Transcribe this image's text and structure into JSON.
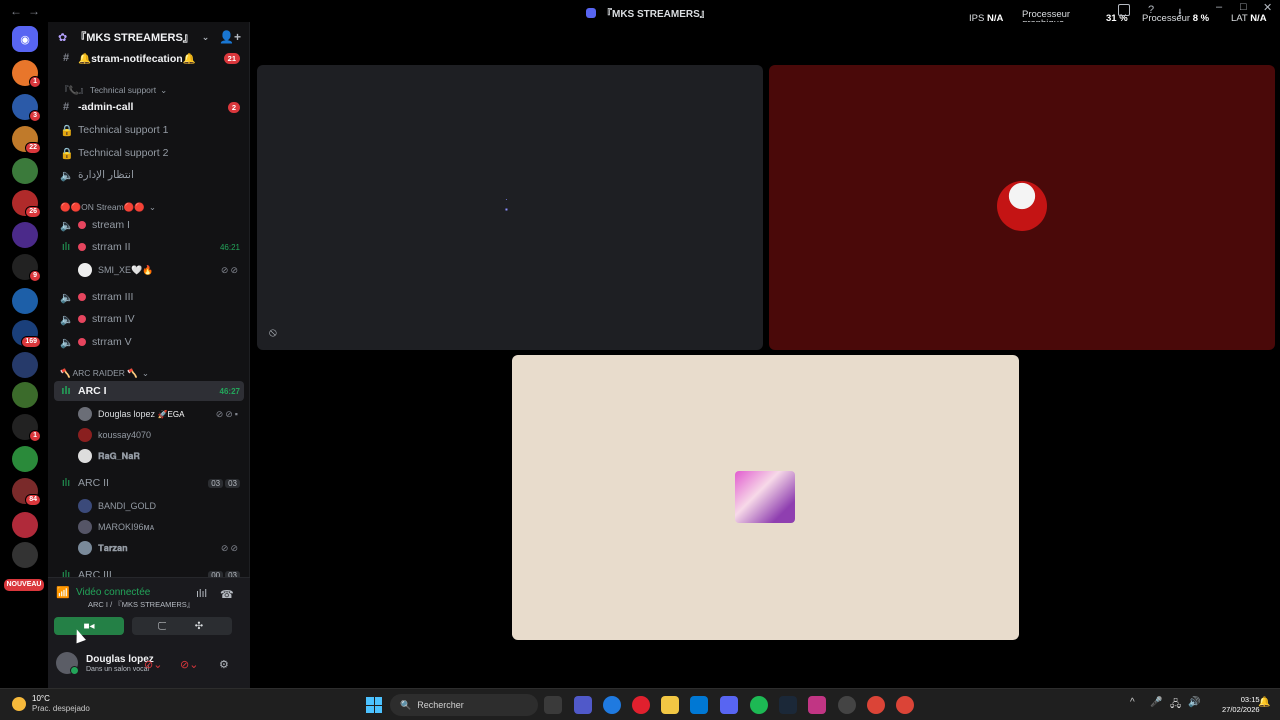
{
  "window": {
    "title": "『MKS STREAMERS』",
    "overlay": {
      "ips_label": "IPS",
      "ips_value": "N/A",
      "gpu_label_1": "Processeur",
      "gpu_label_2": "graphique",
      "gpu_value": "31 %",
      "cpu_label": "Processeur",
      "cpu_value": "8 %",
      "lat_label": "LAT",
      "lat_value": "N/A"
    }
  },
  "servers": {
    "badges": [
      "1",
      "3",
      "22",
      "26",
      "9",
      "169",
      "1",
      "84"
    ],
    "new_label": "NOUVEAU"
  },
  "sidebar": {
    "server_name": "『MKS STREAMERS』",
    "channels": [
      {
        "name": "🔔stram-notifecation🔔",
        "badge": "21"
      },
      {
        "name": "-admin-call",
        "badge": "2"
      },
      {
        "name": "Technical support 1"
      },
      {
        "name": "Technical support 2"
      },
      {
        "name": "انتظار الإدارة"
      },
      {
        "name": "stream I"
      },
      {
        "name": "strram II",
        "timer": "46:21"
      },
      {
        "name": "strram III"
      },
      {
        "name": "strram IV"
      },
      {
        "name": "strram V"
      },
      {
        "name": "ARC I",
        "timer": "46:27"
      },
      {
        "name": "ARC II",
        "count_a": "03",
        "count_b": "03"
      },
      {
        "name": "ARC III",
        "count_a": "00",
        "count_b": "03"
      }
    ],
    "categories": [
      "『📞』 Technical support",
      "🔴🔴ON Stream🔴🔴",
      "🪓 ARC RAIDER 🪓"
    ],
    "users": [
      {
        "name": "SMI_XE🤍🔥"
      },
      {
        "name": "Douglas lopez",
        "tag": "🚀EGA"
      },
      {
        "name": "koussay4070"
      },
      {
        "name": "𝐑𝐚𝐆_𝐍𝐚𝐑"
      },
      {
        "name": "BANDI_GOLD"
      },
      {
        "name": "MAROKI96ᴍᴀ"
      },
      {
        "name": "𝐓𝐚𝐫𝐳𝐚𝐧"
      }
    ]
  },
  "voice": {
    "status": "Vidéo connectée",
    "location": "ARC I / 『MKS STREAMERS』",
    "user_name": "Douglas lopez",
    "user_status": "Dans un salon vocal"
  },
  "taskbar": {
    "weather_temp": "10°C",
    "weather_desc": "Prac. despejado",
    "search_placeholder": "Rechercher",
    "time": "03:15",
    "date": "27/02/2026"
  },
  "colors": {
    "accent": "#5865f2",
    "online": "#23a55a",
    "badge": "#da373c",
    "tile_red": "#4a0909",
    "tile_beige": "#e8dccc"
  }
}
